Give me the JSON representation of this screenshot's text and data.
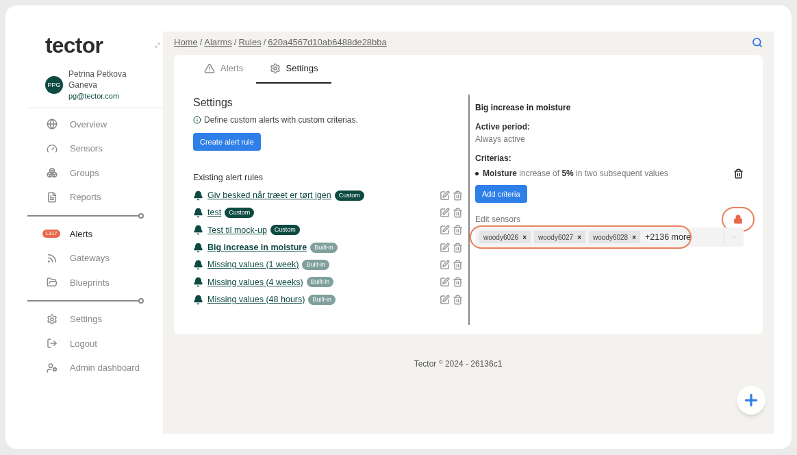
{
  "logo": "tector",
  "user": {
    "initials": "PPG",
    "name": "Petrina Petkova Ganeva",
    "email": "pg@tector.com"
  },
  "nav": [
    {
      "kind": "item",
      "label": "Overview",
      "selected": false
    },
    {
      "kind": "item",
      "label": "Sensors",
      "selected": false
    },
    {
      "kind": "item",
      "label": "Groups",
      "selected": false
    },
    {
      "kind": "item",
      "label": "Reports",
      "selected": false
    },
    {
      "kind": "divider"
    },
    {
      "kind": "item",
      "label": "Alerts",
      "selected": true,
      "badge": "1317"
    },
    {
      "kind": "item",
      "label": "Gateways",
      "selected": false
    },
    {
      "kind": "item",
      "label": "Blueprints",
      "selected": false
    },
    {
      "kind": "divider"
    },
    {
      "kind": "item",
      "label": "Settings",
      "selected": false
    },
    {
      "kind": "item",
      "label": "Logout",
      "selected": false
    },
    {
      "kind": "item",
      "label": "Admin dashboard",
      "selected": false
    }
  ],
  "breadcrumb": {
    "separator": "/",
    "links": [
      "Home",
      "Alarms",
      "Rules",
      "620a4567d10ab6488de28bba"
    ]
  },
  "tabs": [
    {
      "label": "Alerts",
      "selected": false
    },
    {
      "label": "Settings",
      "selected": true
    }
  ],
  "settings": {
    "title": "Settings",
    "info": "Define custom alerts with custom criterias.",
    "create_button": "Create alert rule",
    "rules_title": "Existing alert rules",
    "rules": [
      {
        "name": "Giv besked når træet er tørt igen",
        "tag": "Custom",
        "kind": "custom",
        "selected": false
      },
      {
        "name": "test",
        "tag": "Custom",
        "kind": "custom",
        "selected": false
      },
      {
        "name": "Test til mock-up",
        "tag": "Custom",
        "kind": "custom",
        "selected": false
      },
      {
        "name": "Big increase in moisture",
        "tag": "Built-in",
        "kind": "builtin",
        "selected": true
      },
      {
        "name": "Missing values (1 week)",
        "tag": "Built-in",
        "kind": "builtin",
        "selected": false
      },
      {
        "name": "Missing values (4 weeks)",
        "tag": "Built-in",
        "kind": "builtin",
        "selected": false
      },
      {
        "name": "Missing values (48 hours)",
        "tag": "Built-in",
        "kind": "builtin",
        "selected": false
      }
    ]
  },
  "detail": {
    "title": "Big increase in moisture",
    "period_label": "Active period:",
    "period": "Always active",
    "criteria_label": "Criterias:",
    "criteria": [
      "**Moisture** increase of **5%** in two subsequent values"
    ],
    "add_button": "Add criteria",
    "sensors_label": "Edit sensors",
    "locked": true,
    "lock_highlighted": true,
    "field_highlighted": true,
    "sensors": [
      "woody6026",
      "woody6027",
      "woody6028"
    ],
    "remove_mark": "×",
    "more": "+2136 more"
  },
  "footer": "Tector $^{©}$ 2024 - 26136c1"
}
